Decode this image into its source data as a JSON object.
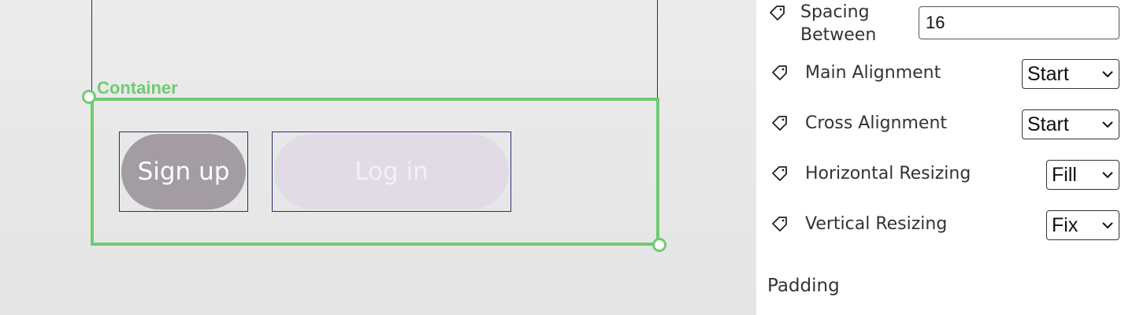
{
  "canvas": {
    "container_label": "Container",
    "buttons": {
      "signup_label": "Sign up",
      "login_label": "Log in"
    },
    "accent_color": "#6fcb72",
    "frame_color": "#2e2a78"
  },
  "panel": {
    "spacing_between": {
      "label_line1": "Spacing",
      "label_line2": "Between",
      "value": "16"
    },
    "main_alignment": {
      "label": "Main Alignment",
      "value": "Start"
    },
    "cross_alignment": {
      "label": "Cross Alignment",
      "value": "Start"
    },
    "horizontal_resizing": {
      "label": "Horizontal Resizing",
      "value": "Fill"
    },
    "vertical_resizing": {
      "label": "Vertical Resizing",
      "value": "Fix"
    },
    "padding_title": "Padding",
    "icons": {
      "property_icon": "tag-icon",
      "dropdown_icon": "chevron-down-icon"
    }
  }
}
